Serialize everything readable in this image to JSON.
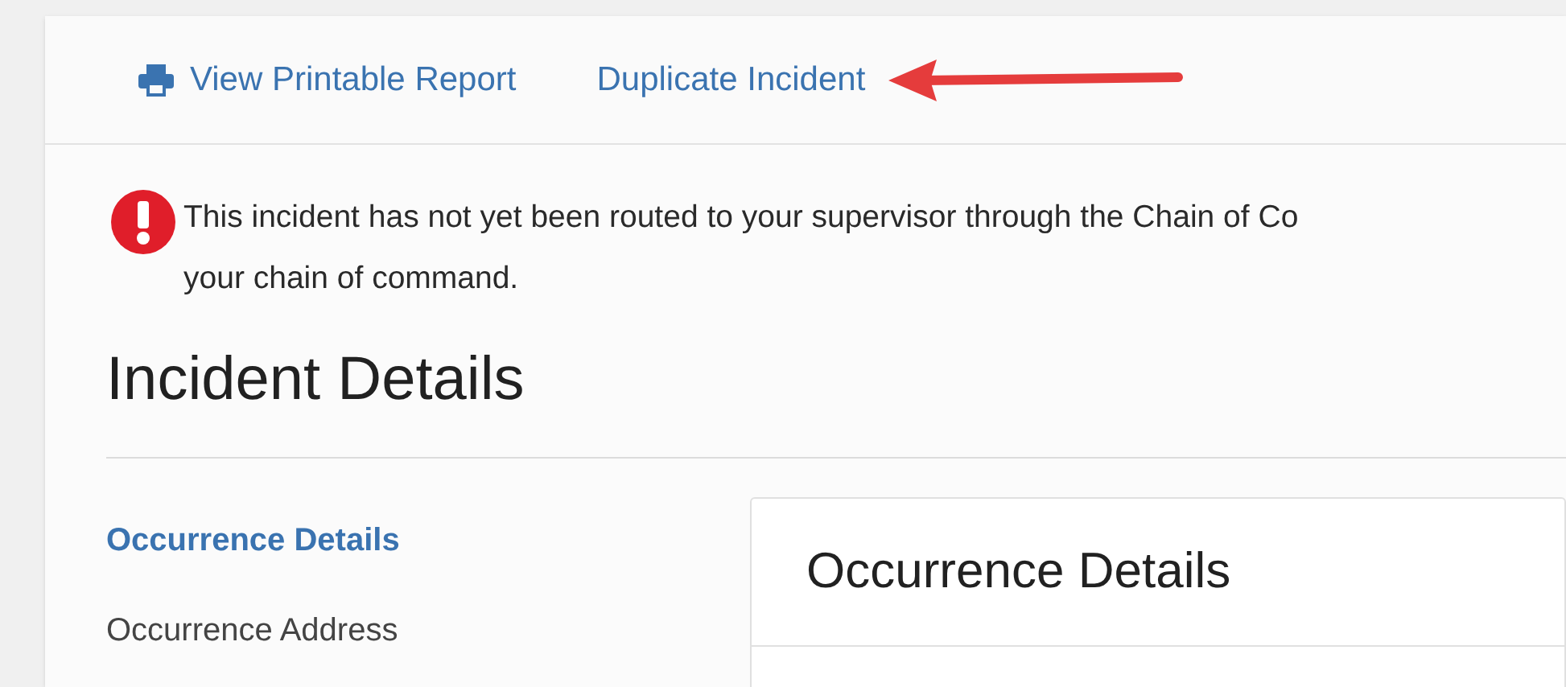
{
  "toolbar": {
    "links": [
      {
        "kind": "print",
        "label": "View Printable Report"
      },
      {
        "kind": "plain",
        "label": "Duplicate Incident"
      }
    ]
  },
  "alert": {
    "lines": [
      "This incident has not yet been routed to your supervisor through the Chain of Co",
      "your chain of command."
    ]
  },
  "heading": "Incident Details",
  "sidebar": {
    "items": [
      {
        "label": "Occurrence Details",
        "selected": true
      },
      {
        "label": "Occurrence Address",
        "selected": false
      }
    ]
  },
  "card": {
    "title": "Occurrence Details"
  }
}
